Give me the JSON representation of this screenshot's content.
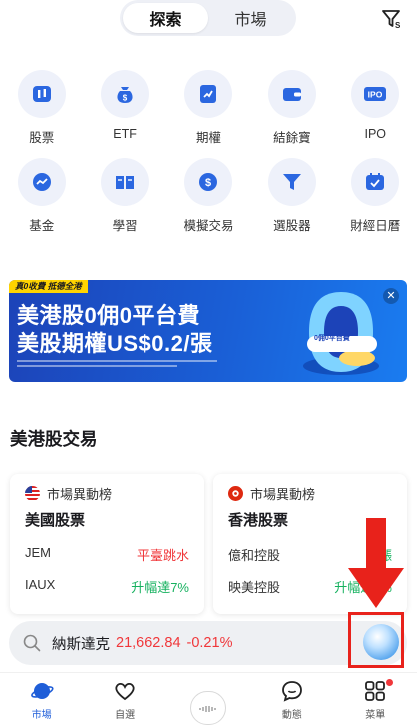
{
  "header": {
    "tabs": [
      {
        "label": "探索",
        "active": true
      },
      {
        "label": "市場",
        "active": false
      }
    ],
    "filter_icon": "filter-s-icon"
  },
  "grid": {
    "row1": [
      {
        "label": "股票",
        "icon": "stock-icon"
      },
      {
        "label": "ETF",
        "icon": "money-bag-icon"
      },
      {
        "label": "期權",
        "icon": "options-chart-icon"
      },
      {
        "label": "結餘寶",
        "icon": "wallet-icon"
      },
      {
        "label": "IPO",
        "icon": "ipo-icon"
      }
    ],
    "row2": [
      {
        "label": "基金",
        "icon": "fund-icon"
      },
      {
        "label": "學習",
        "icon": "book-icon"
      },
      {
        "label": "模擬交易",
        "icon": "simulated-coin-icon"
      },
      {
        "label": "選股器",
        "icon": "funnel-icon"
      },
      {
        "label": "財經日曆",
        "icon": "calendar-icon"
      }
    ]
  },
  "banner": {
    "tag": "真0收費 抵德全港",
    "line1": "美港股0佣0平台費",
    "line2": "美股期權US$0.2/張",
    "art_text": "0佣0平台費"
  },
  "section": {
    "title": "美港股交易"
  },
  "cards": [
    {
      "head": "市場異動榜",
      "title": "美國股票",
      "flag": "us-flag-icon",
      "rows": [
        {
          "name": "JEM",
          "value": "平臺跳水",
          "color": "red"
        },
        {
          "name": "IAUX",
          "value": "升幅達7%",
          "color": "green"
        }
      ]
    },
    {
      "head": "市場異動榜",
      "title": "香港股票",
      "flag": "hk-flag-icon",
      "rows": [
        {
          "name": "億和控股",
          "value": "大漲",
          "color": "green"
        },
        {
          "name": "映美控股",
          "value": "升幅達7%",
          "color": "green"
        }
      ]
    }
  ],
  "search": {
    "name": "納斯達克",
    "value": "21,662.84",
    "change": "-0.21%"
  },
  "bottom_nav": [
    {
      "label": "市場",
      "icon": "planet-icon",
      "active": true
    },
    {
      "label": "自選",
      "icon": "heart-icon",
      "active": false
    },
    {
      "label": "",
      "icon": "center-wave-icon",
      "active": false
    },
    {
      "label": "動態",
      "icon": "chat-bubble-icon",
      "active": false
    },
    {
      "label": "菜單",
      "icon": "menu-grid-icon",
      "active": false
    }
  ],
  "colors": {
    "accent": "#1f5ed8",
    "up_red": "#f0373a",
    "down_green": "#16b15f",
    "annotation_red": "#e8221b"
  }
}
